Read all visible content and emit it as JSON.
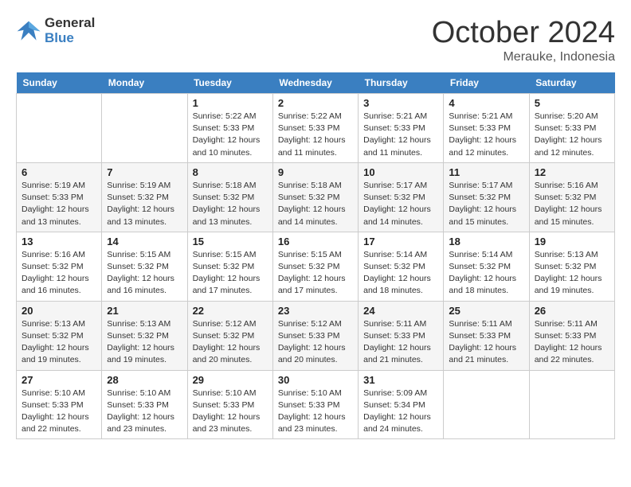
{
  "logo": {
    "text_general": "General",
    "text_blue": "Blue"
  },
  "header": {
    "month": "October 2024",
    "location": "Merauke, Indonesia"
  },
  "weekdays": [
    "Sunday",
    "Monday",
    "Tuesday",
    "Wednesday",
    "Thursday",
    "Friday",
    "Saturday"
  ],
  "weeks": [
    [
      null,
      null,
      {
        "day": 1,
        "sunrise": "5:22 AM",
        "sunset": "5:33 PM",
        "daylight": "12 hours and 10 minutes."
      },
      {
        "day": 2,
        "sunrise": "5:22 AM",
        "sunset": "5:33 PM",
        "daylight": "12 hours and 11 minutes."
      },
      {
        "day": 3,
        "sunrise": "5:21 AM",
        "sunset": "5:33 PM",
        "daylight": "12 hours and 11 minutes."
      },
      {
        "day": 4,
        "sunrise": "5:21 AM",
        "sunset": "5:33 PM",
        "daylight": "12 hours and 12 minutes."
      },
      {
        "day": 5,
        "sunrise": "5:20 AM",
        "sunset": "5:33 PM",
        "daylight": "12 hours and 12 minutes."
      }
    ],
    [
      {
        "day": 6,
        "sunrise": "5:19 AM",
        "sunset": "5:33 PM",
        "daylight": "12 hours and 13 minutes."
      },
      {
        "day": 7,
        "sunrise": "5:19 AM",
        "sunset": "5:32 PM",
        "daylight": "12 hours and 13 minutes."
      },
      {
        "day": 8,
        "sunrise": "5:18 AM",
        "sunset": "5:32 PM",
        "daylight": "12 hours and 13 minutes."
      },
      {
        "day": 9,
        "sunrise": "5:18 AM",
        "sunset": "5:32 PM",
        "daylight": "12 hours and 14 minutes."
      },
      {
        "day": 10,
        "sunrise": "5:17 AM",
        "sunset": "5:32 PM",
        "daylight": "12 hours and 14 minutes."
      },
      {
        "day": 11,
        "sunrise": "5:17 AM",
        "sunset": "5:32 PM",
        "daylight": "12 hours and 15 minutes."
      },
      {
        "day": 12,
        "sunrise": "5:16 AM",
        "sunset": "5:32 PM",
        "daylight": "12 hours and 15 minutes."
      }
    ],
    [
      {
        "day": 13,
        "sunrise": "5:16 AM",
        "sunset": "5:32 PM",
        "daylight": "12 hours and 16 minutes."
      },
      {
        "day": 14,
        "sunrise": "5:15 AM",
        "sunset": "5:32 PM",
        "daylight": "12 hours and 16 minutes."
      },
      {
        "day": 15,
        "sunrise": "5:15 AM",
        "sunset": "5:32 PM",
        "daylight": "12 hours and 17 minutes."
      },
      {
        "day": 16,
        "sunrise": "5:15 AM",
        "sunset": "5:32 PM",
        "daylight": "12 hours and 17 minutes."
      },
      {
        "day": 17,
        "sunrise": "5:14 AM",
        "sunset": "5:32 PM",
        "daylight": "12 hours and 18 minutes."
      },
      {
        "day": 18,
        "sunrise": "5:14 AM",
        "sunset": "5:32 PM",
        "daylight": "12 hours and 18 minutes."
      },
      {
        "day": 19,
        "sunrise": "5:13 AM",
        "sunset": "5:32 PM",
        "daylight": "12 hours and 19 minutes."
      }
    ],
    [
      {
        "day": 20,
        "sunrise": "5:13 AM",
        "sunset": "5:32 PM",
        "daylight": "12 hours and 19 minutes."
      },
      {
        "day": 21,
        "sunrise": "5:13 AM",
        "sunset": "5:32 PM",
        "daylight": "12 hours and 19 minutes."
      },
      {
        "day": 22,
        "sunrise": "5:12 AM",
        "sunset": "5:32 PM",
        "daylight": "12 hours and 20 minutes."
      },
      {
        "day": 23,
        "sunrise": "5:12 AM",
        "sunset": "5:33 PM",
        "daylight": "12 hours and 20 minutes."
      },
      {
        "day": 24,
        "sunrise": "5:11 AM",
        "sunset": "5:33 PM",
        "daylight": "12 hours and 21 minutes."
      },
      {
        "day": 25,
        "sunrise": "5:11 AM",
        "sunset": "5:33 PM",
        "daylight": "12 hours and 21 minutes."
      },
      {
        "day": 26,
        "sunrise": "5:11 AM",
        "sunset": "5:33 PM",
        "daylight": "12 hours and 22 minutes."
      }
    ],
    [
      {
        "day": 27,
        "sunrise": "5:10 AM",
        "sunset": "5:33 PM",
        "daylight": "12 hours and 22 minutes."
      },
      {
        "day": 28,
        "sunrise": "5:10 AM",
        "sunset": "5:33 PM",
        "daylight": "12 hours and 23 minutes."
      },
      {
        "day": 29,
        "sunrise": "5:10 AM",
        "sunset": "5:33 PM",
        "daylight": "12 hours and 23 minutes."
      },
      {
        "day": 30,
        "sunrise": "5:10 AM",
        "sunset": "5:33 PM",
        "daylight": "12 hours and 23 minutes."
      },
      {
        "day": 31,
        "sunrise": "5:09 AM",
        "sunset": "5:34 PM",
        "daylight": "12 hours and 24 minutes."
      },
      null,
      null
    ]
  ]
}
